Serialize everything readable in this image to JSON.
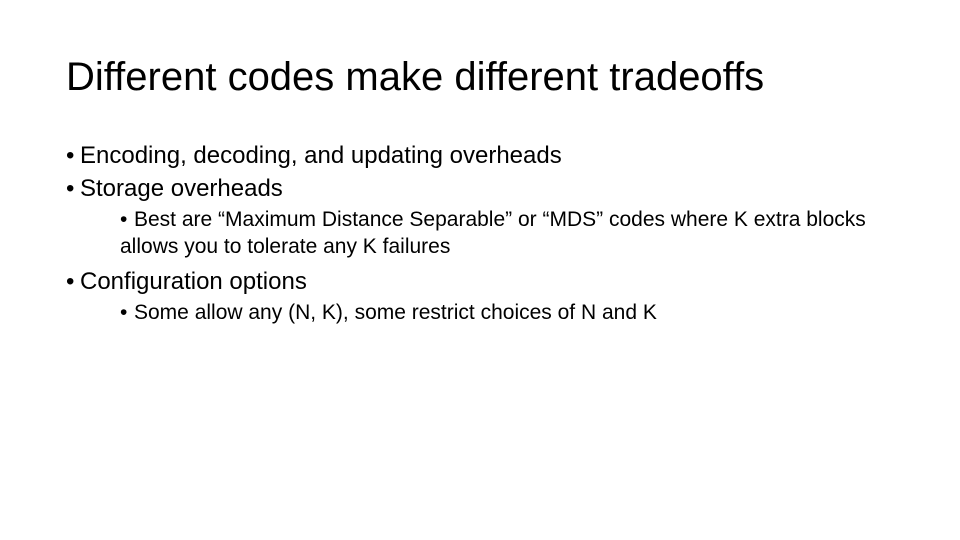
{
  "title": "Different codes make different tradeoffs",
  "bullets": {
    "b1": "Encoding, decoding, and updating overheads",
    "b2": "Storage overheads",
    "b2a": "Best are “Maximum Distance Separable” or  “MDS” codes where K extra blocks allows you to tolerate any K failures",
    "b3": "Configuration options",
    "b3a": "Some allow any (N, K), some restrict choices of N and K"
  }
}
